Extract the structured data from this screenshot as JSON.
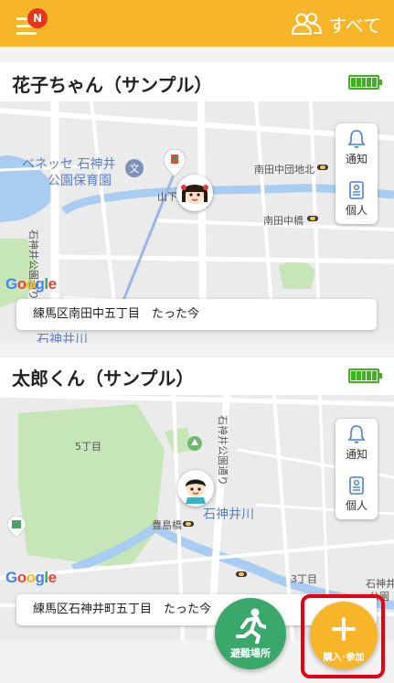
{
  "header": {
    "notification_badge": "N",
    "all_label": "すべて",
    "icons": [
      "menu-icon",
      "people-icon"
    ],
    "color": "#f7b52a"
  },
  "cards": [
    {
      "name": "花子ちゃん（サンプル）",
      "battery_level": 1.0,
      "address": "練馬区南田中五丁目　たった今",
      "side_panel": {
        "notify": "通知",
        "personal": "個人"
      },
      "map_labels": {
        "school": "ベネッセ 石神井\n公園保育園",
        "school_line1": "ベネッセ 石神井",
        "school_line2": "公園保育園",
        "yamashita": "山下",
        "danchi": "南田中団地北",
        "bridge": "南田中橋",
        "river": "石神井川",
        "street": "石神井公園通り"
      }
    },
    {
      "name": "太郎くん（サンプル）",
      "battery_level": 1.0,
      "address": "練馬区石神井町五丁目　たった今",
      "side_panel": {
        "notify": "通知",
        "personal": "個人"
      },
      "map_labels": {
        "chome5": "5丁目",
        "street": "石神井公園通り",
        "river": "石神井川",
        "toshima": "豊島橋",
        "chome3": "3丁目",
        "station_a": "石神井",
        "station_b": "公園"
      }
    }
  ],
  "map_attribution": "Google",
  "fab": {
    "evacuation_label": "避難場所",
    "join_label": "購入･参加"
  },
  "colors": {
    "accent": "#f7b52a",
    "battery": "#3cb31f",
    "evac": "#3aa86b",
    "highlight": "#e60012"
  }
}
